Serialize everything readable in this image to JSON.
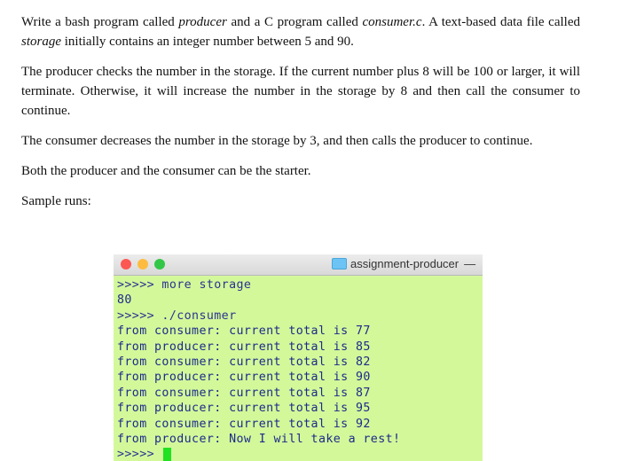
{
  "document": {
    "paragraphs": [
      {
        "parts": [
          {
            "text": "Write a bash program called ",
            "italic": false
          },
          {
            "text": "producer",
            "italic": true
          },
          {
            "text": " and a C program called ",
            "italic": false
          },
          {
            "text": "consumer.c",
            "italic": true
          },
          {
            "text": ". A text-based data file called ",
            "italic": false
          },
          {
            "text": "storage",
            "italic": true
          },
          {
            "text": " initially contains an integer number between 5 and 90.",
            "italic": false
          }
        ]
      },
      {
        "parts": [
          {
            "text": "The producer checks the number in the storage. If the current number plus 8 will be 100 or larger, it will terminate. Otherwise, it will increase the number in the storage by 8 and then call the consumer to continue.",
            "italic": false
          }
        ]
      },
      {
        "parts": [
          {
            "text": "The consumer decreases the number in the storage by 3, and then calls the producer to continue.",
            "italic": false
          }
        ]
      },
      {
        "parts": [
          {
            "text": "Both the producer and the consumer can be the starter.",
            "italic": false
          }
        ]
      },
      {
        "parts": [
          {
            "text": "Sample runs:",
            "italic": false
          }
        ]
      }
    ]
  },
  "terminal": {
    "title": "assignment-producer",
    "title_suffix": "—",
    "icons": {
      "close": "close-light",
      "minimize": "minimize-light",
      "zoom": "zoom-light",
      "folder": "folder-icon"
    },
    "colors": {
      "background": "#d3f89a",
      "text": "#1d2b8a",
      "cursor": "#22e022"
    },
    "lines": [
      ">>>>> more storage",
      "80",
      ">>>>> ./consumer",
      "from consumer: current total is 77",
      "from producer: current total is 85",
      "from consumer: current total is 82",
      "from producer: current total is 90",
      "from consumer: current total is 87",
      "from producer: current total is 95",
      "from consumer: current total is 92",
      "from producer: Now I will take a rest!"
    ],
    "final_prompt": ">>>>> "
  }
}
